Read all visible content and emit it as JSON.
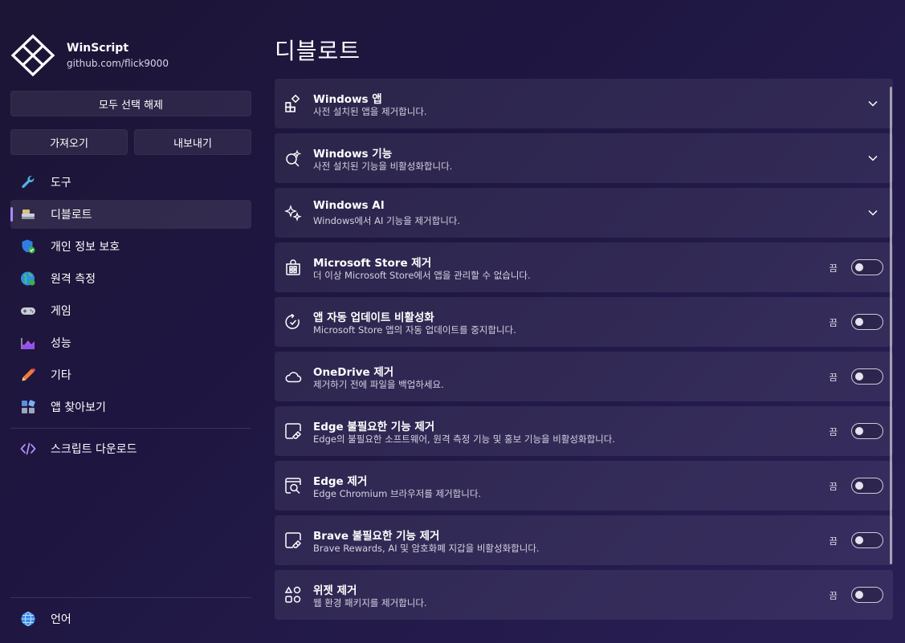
{
  "app": {
    "title": "WinScript",
    "subtitle": "github.com/flick9000"
  },
  "sidebar": {
    "deselect_all": "모두 선택 해제",
    "import": "가져오기",
    "export": "내보내기",
    "items": [
      {
        "label": "도구",
        "icon": "wrench-icon"
      },
      {
        "label": "디블로트",
        "icon": "broom-icon",
        "active": true
      },
      {
        "label": "개인 정보 보호",
        "icon": "shield-icon"
      },
      {
        "label": "원격 측정",
        "icon": "globe-icon"
      },
      {
        "label": "게임",
        "icon": "gamepad-icon"
      },
      {
        "label": "성능",
        "icon": "chart-icon"
      },
      {
        "label": "기타",
        "icon": "pencil-icon"
      },
      {
        "label": "앱 찾아보기",
        "icon": "apps-icon"
      }
    ],
    "download": {
      "label": "스크립트 다운로드",
      "icon": "code-icon"
    },
    "language": {
      "label": "언어",
      "icon": "globe-icon"
    }
  },
  "main": {
    "title": "디블로트",
    "toggle_off_label": "끔",
    "cards": [
      {
        "title": "Windows 앱",
        "desc": "사전 설치된 앱을 제거합니다.",
        "type": "expander",
        "icon": "apps-grid-icon"
      },
      {
        "title": "Windows 기능",
        "desc": "사전 설치된 기능을 비활성화합니다.",
        "type": "expander",
        "icon": "sparkle-search-icon"
      },
      {
        "title": "Windows AI",
        "desc": "Windows에서 AI 기능을 제거합니다.",
        "type": "expander",
        "icon": "sparkles-icon"
      },
      {
        "title": "Microsoft Store 제거",
        "desc": "더 이상 Microsoft Store에서 앱을 관리할 수 없습니다.",
        "type": "toggle",
        "state": "off",
        "icon": "store-icon"
      },
      {
        "title": "앱 자동 업데이트 비활성화",
        "desc": "Microsoft Store 앱의 자동 업데이트를 중지합니다.",
        "type": "toggle",
        "state": "off",
        "icon": "update-icon"
      },
      {
        "title": "OneDrive 제거",
        "desc": "제거하기 전에 파일을 백업하세요.",
        "type": "toggle",
        "state": "off",
        "icon": "cloud-icon"
      },
      {
        "title": "Edge 불필요한 기능 제거",
        "desc": "Edge의 불필요한 소프트웨어, 원격 측정 기능 및 홍보 기능을 비활성화합니다.",
        "type": "toggle",
        "state": "off",
        "icon": "eraser-icon"
      },
      {
        "title": "Edge 제거",
        "desc": "Edge Chromium 브라우저를 제거합니다.",
        "type": "toggle",
        "state": "off",
        "icon": "browser-search-icon"
      },
      {
        "title": "Brave 불필요한 기능 제거",
        "desc": "Brave Rewards, AI 및 암호화폐 지갑을 비활성화합니다.",
        "type": "toggle",
        "state": "off",
        "icon": "eraser-icon"
      },
      {
        "title": "위젯 제거",
        "desc": "웹 환경 패키지를 제거합니다.",
        "type": "toggle",
        "state": "off",
        "icon": "shapes-icon"
      }
    ]
  }
}
